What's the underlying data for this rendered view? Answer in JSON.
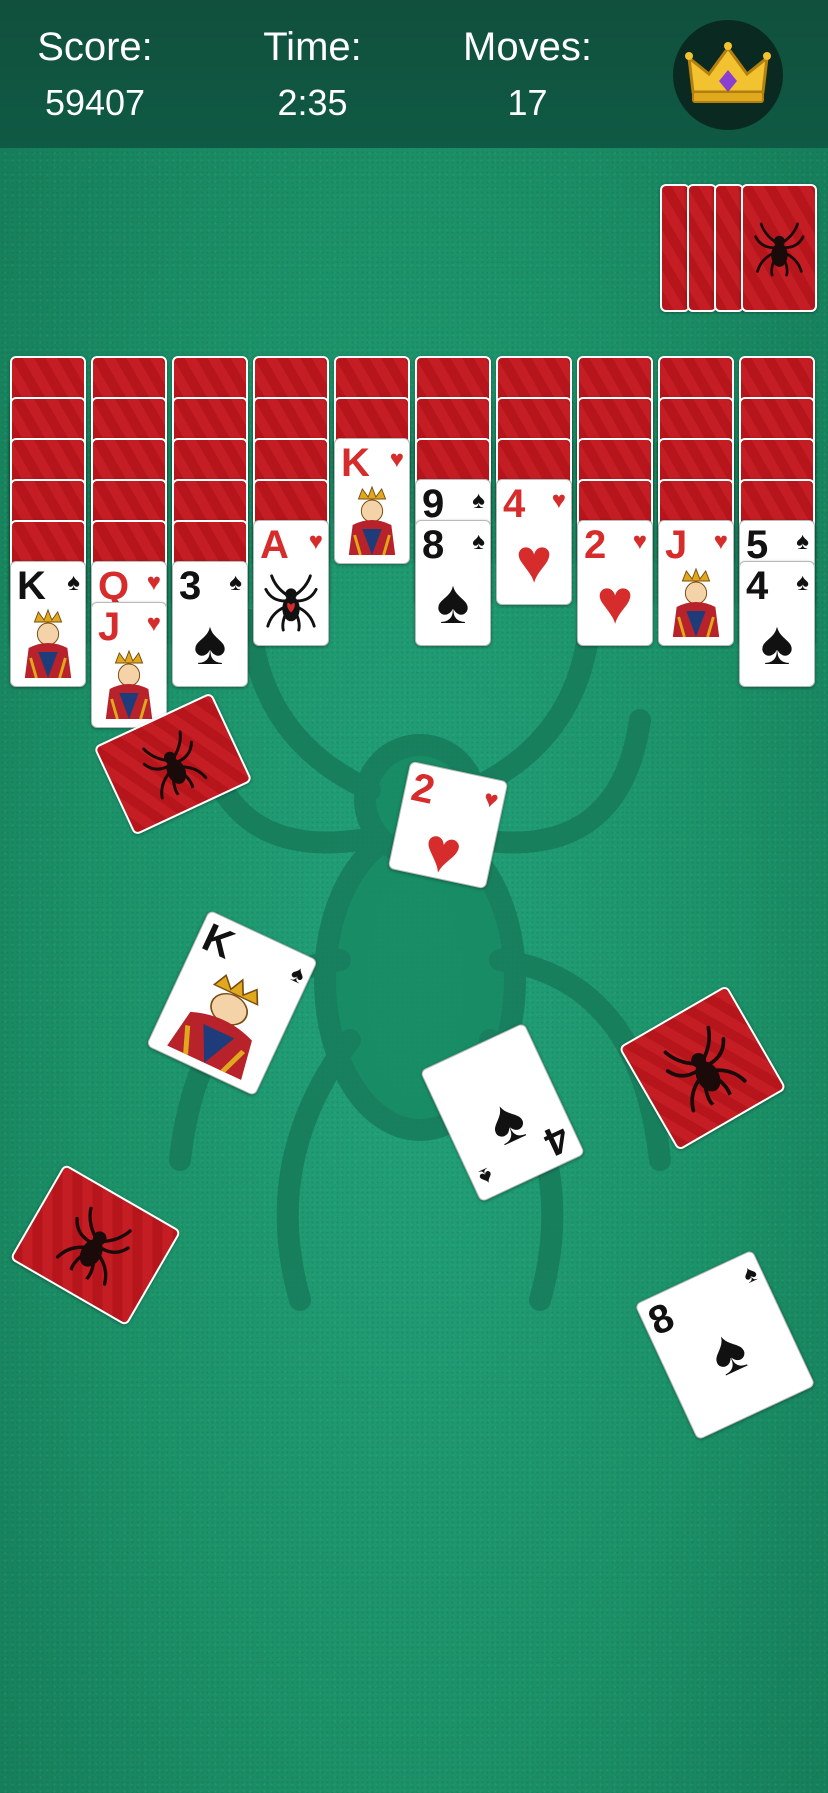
{
  "header": {
    "score_label": "Score:",
    "score_value": "59407",
    "time_label": "Time:",
    "time_value": "2:35",
    "moves_label": "Moves:",
    "moves_value": "17"
  },
  "stock": {
    "remaining_deals": 4
  },
  "tableau": [
    {
      "hidden": 5,
      "up": [
        {
          "rank": "K",
          "suit": "♠",
          "color": "black",
          "face": true
        }
      ]
    },
    {
      "hidden": 5,
      "up": [
        {
          "rank": "Q",
          "suit": "♥",
          "color": "red",
          "face": true
        },
        {
          "rank": "J",
          "suit": "♥",
          "color": "red",
          "face": true
        }
      ]
    },
    {
      "hidden": 5,
      "up": [
        {
          "rank": "3",
          "suit": "♠",
          "color": "black"
        }
      ]
    },
    {
      "hidden": 4,
      "up": [
        {
          "rank": "A",
          "suit": "♥",
          "color": "red",
          "spider": true
        }
      ]
    },
    {
      "hidden": 2,
      "up": [
        {
          "rank": "K",
          "suit": "♥",
          "color": "red",
          "face": true
        }
      ]
    },
    {
      "hidden": 3,
      "up": [
        {
          "rank": "9",
          "suit": "♠",
          "color": "black"
        },
        {
          "rank": "8",
          "suit": "♠",
          "color": "black"
        }
      ]
    },
    {
      "hidden": 3,
      "up": [
        {
          "rank": "4",
          "suit": "♥",
          "color": "red"
        }
      ]
    },
    {
      "hidden": 4,
      "up": [
        {
          "rank": "2",
          "suit": "♥",
          "color": "red"
        }
      ]
    },
    {
      "hidden": 4,
      "up": [
        {
          "rank": "J",
          "suit": "♥",
          "color": "red",
          "face": true
        }
      ]
    },
    {
      "hidden": 4,
      "up": [
        {
          "rank": "5",
          "suit": "♠",
          "color": "black"
        },
        {
          "rank": "4",
          "suit": "♠",
          "color": "black"
        }
      ]
    }
  ],
  "scattered": [
    {
      "kind": "back"
    },
    {
      "kind": "face",
      "rank": "2",
      "suit": "♥",
      "color": "red"
    },
    {
      "kind": "face",
      "rank": "K",
      "suit": "♠",
      "color": "black",
      "face": true
    },
    {
      "kind": "face",
      "rank": "4",
      "suit": "♠",
      "color": "black",
      "upside_down": true
    },
    {
      "kind": "back"
    },
    {
      "kind": "back"
    },
    {
      "kind": "face",
      "rank": "8",
      "suit": "♠",
      "color": "black"
    }
  ],
  "colors": {
    "felt": "#1f9470",
    "header": "#10503d",
    "card_back": "#c41e24",
    "red_suit": "#d62c2c"
  },
  "icons": {
    "crown": "crown-icon",
    "spider": "spider-icon"
  }
}
